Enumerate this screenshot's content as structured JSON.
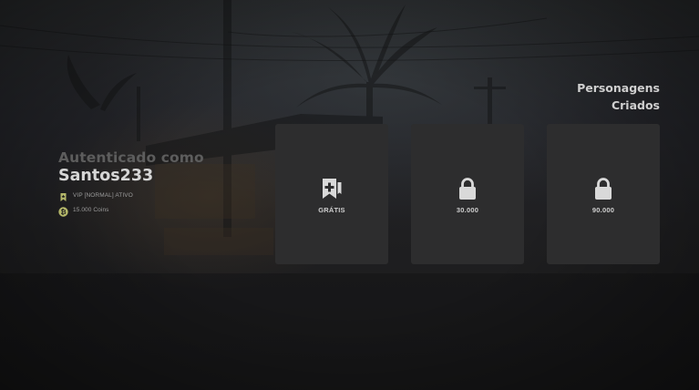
{
  "auth": {
    "label": "Autenticado como",
    "username": "Santos233",
    "vip_status": "VIP [NORMAL] ATIVO",
    "coins": "15.000 Coins"
  },
  "characters": {
    "title_line1": "Personagens",
    "title_line2": "Criados",
    "slots": [
      {
        "label": "GRÁTIS",
        "icon": "bookmark-plus-icon"
      },
      {
        "label": "30.000",
        "icon": "lock-icon"
      },
      {
        "label": "90.000",
        "icon": "lock-icon"
      }
    ]
  },
  "colors": {
    "accent": "#b5b86a",
    "slot_bg": "#2d2d2e",
    "text_light": "#d6d6d6",
    "text_muted": "#5d5d5d"
  }
}
